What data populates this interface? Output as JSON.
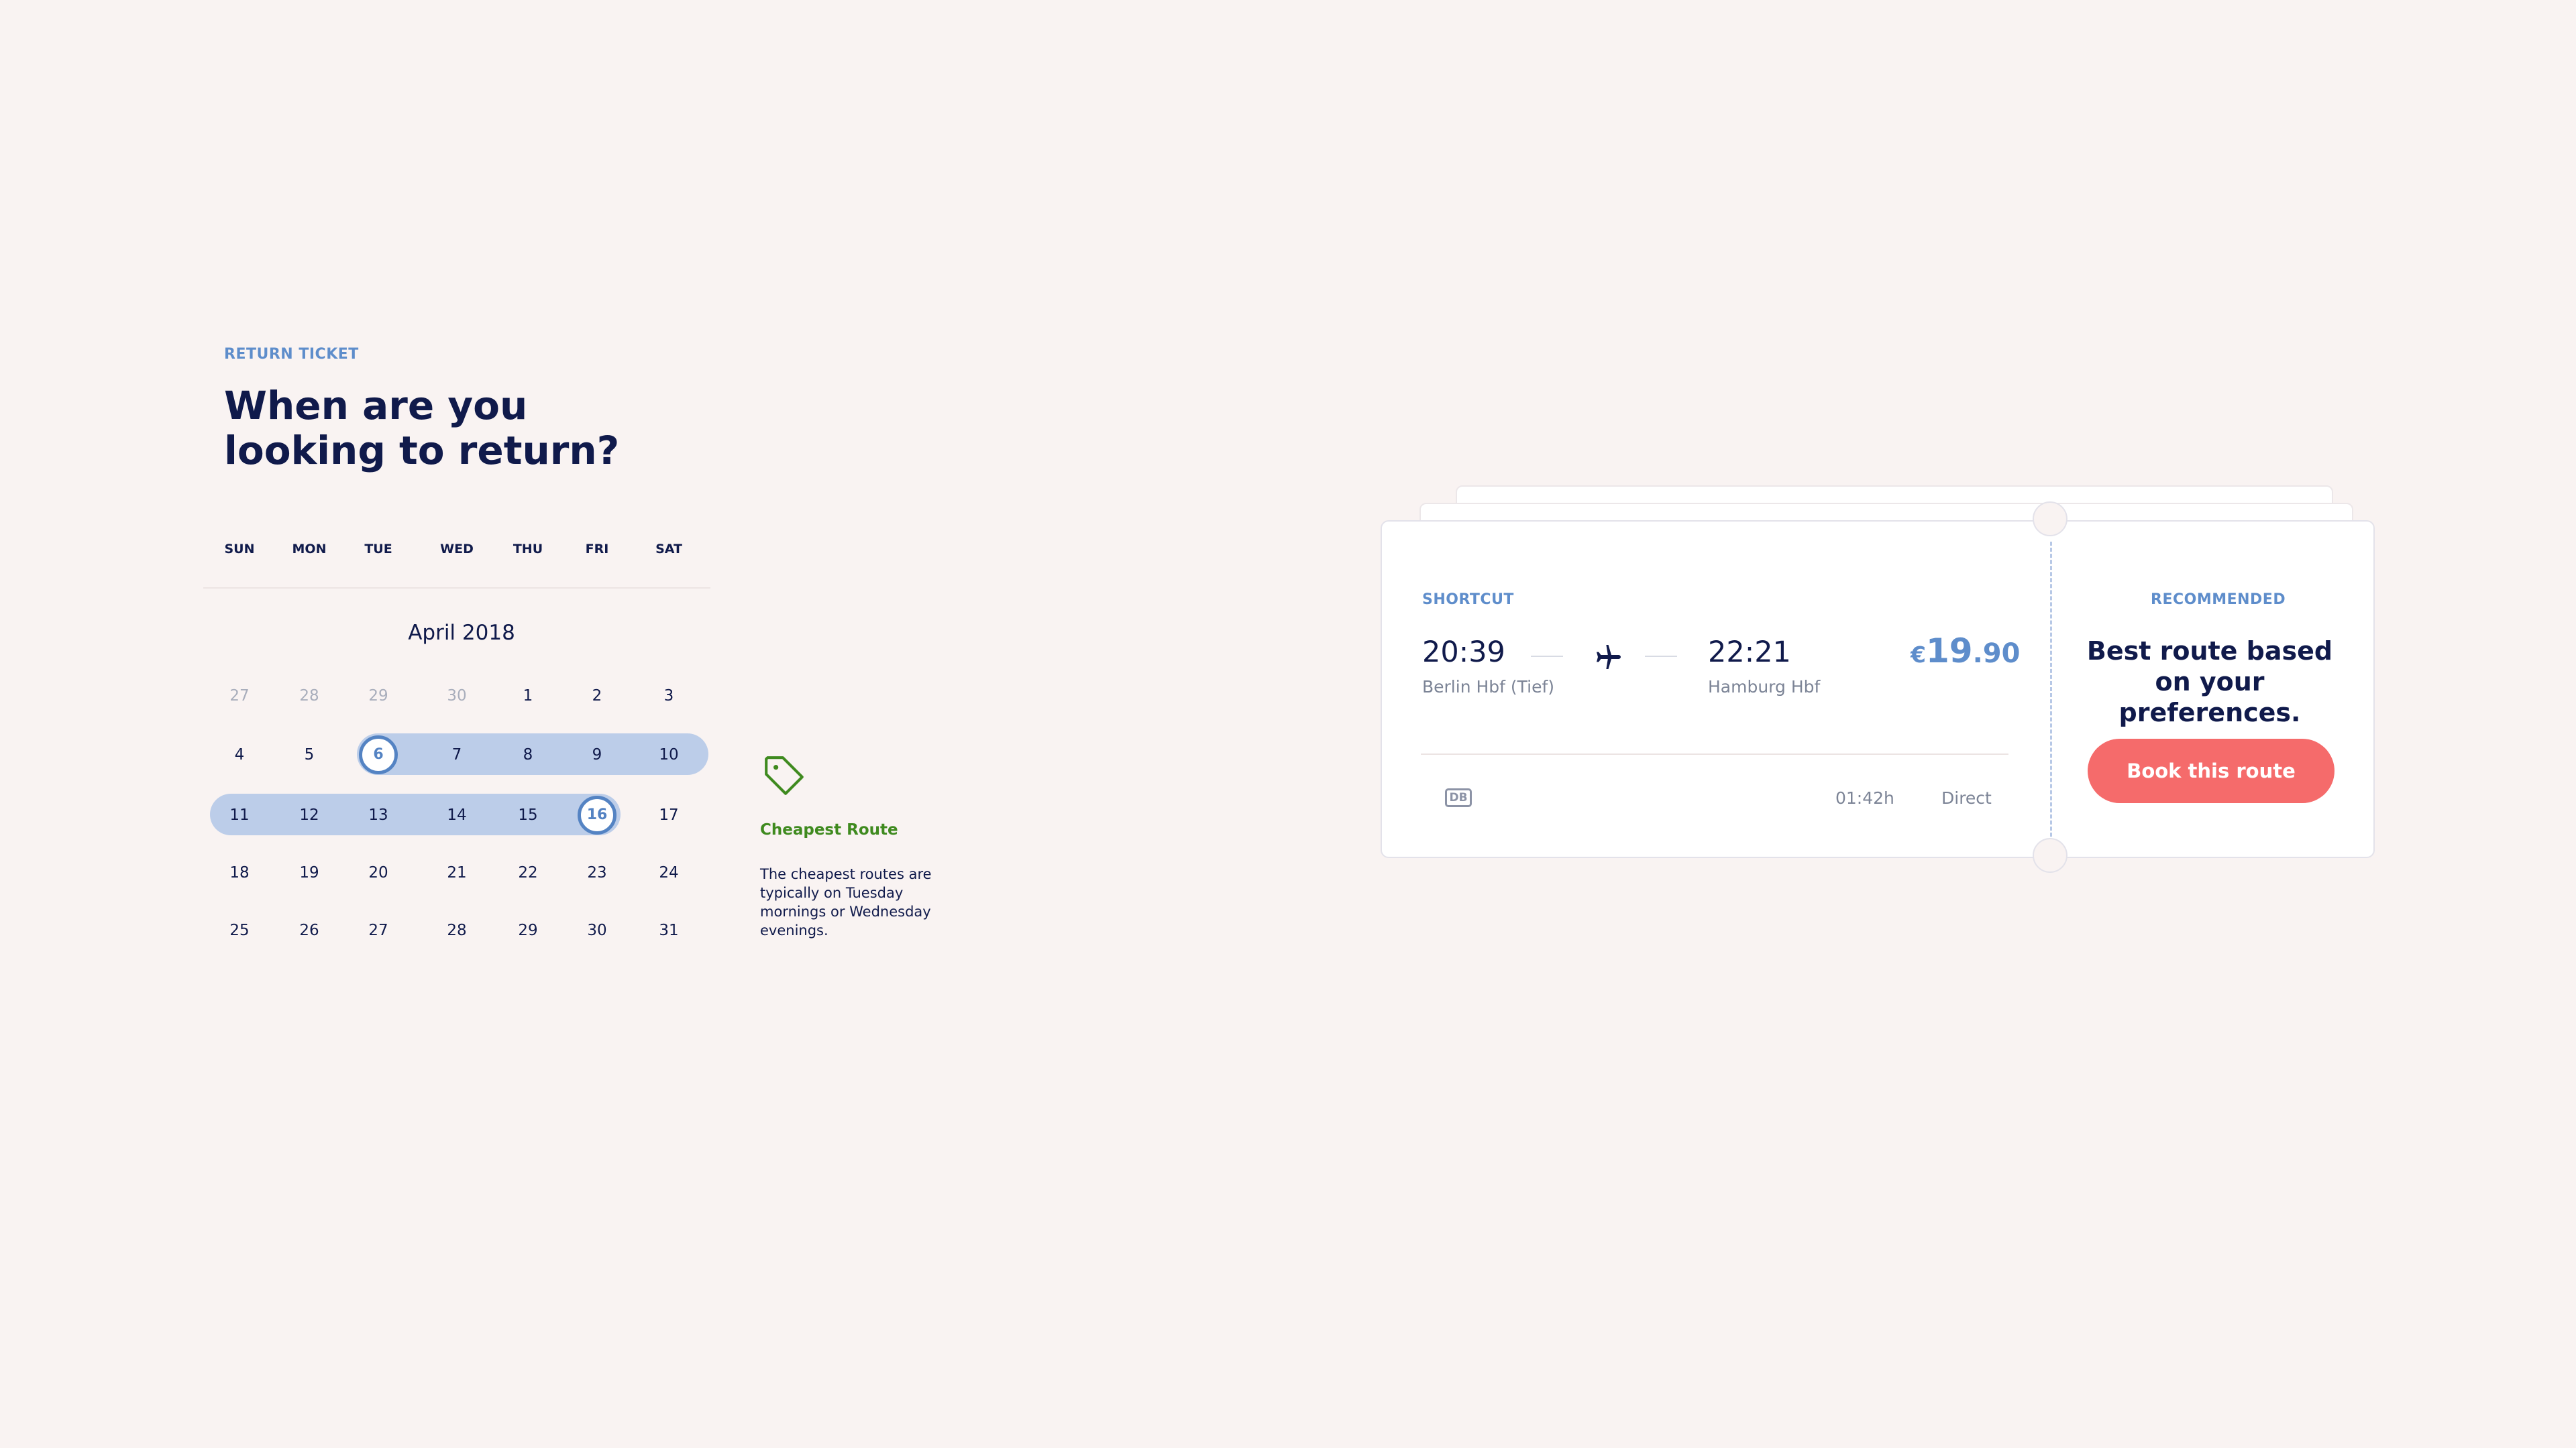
{
  "header": {
    "eyebrow": "RETURN TICKET",
    "title_line1": "When are you",
    "title_line2": "looking to return?"
  },
  "calendar": {
    "weekdays": [
      "SUN",
      "MON",
      "TUE",
      "WED",
      "THU",
      "FRI",
      "SAT"
    ],
    "month_title": "April 2018",
    "rows": [
      [
        "27",
        "28",
        "29",
        "30",
        "1",
        "2",
        "3"
      ],
      [
        "4",
        "5",
        "6",
        "7",
        "8",
        "9",
        "10"
      ],
      [
        "11",
        "12",
        "13",
        "14",
        "15",
        "16",
        "17"
      ],
      [
        "18",
        "19",
        "20",
        "21",
        "22",
        "23",
        "24"
      ],
      [
        "25",
        "26",
        "27",
        "28",
        "29",
        "30",
        "31"
      ]
    ],
    "muted_in_first_row": [
      "27",
      "28",
      "29",
      "30"
    ],
    "range_start": "6",
    "range_end": "16"
  },
  "tip": {
    "icon": "price-tag-icon",
    "title": "Cheapest Route",
    "body": "The cheapest routes are typically on Tuesday mornings or Wednesday evenings."
  },
  "ticket": {
    "eyebrow": "SHORTCUT",
    "depart_time": "20:39",
    "depart_station": "Berlin Hbf (Tief)",
    "arrive_time": "22:21",
    "arrive_station": "Hamburg Hbf",
    "transport_icon": "airplane-icon",
    "price_currency": "€",
    "price_whole": "19",
    "price_cents": ".90",
    "operator": "DB",
    "duration": "01:42h",
    "stops": "Direct"
  },
  "recommended": {
    "eyebrow": "RECOMMENDED",
    "title": "Best route based on your preferences.",
    "button_label": "Book this route"
  },
  "colors": {
    "background": "#f9f3f2",
    "navy": "#101a4b",
    "accent_blue": "#5e8dcb",
    "range_fill": "#bccde9",
    "tip_green": "#3f8a1f",
    "cta": "#f56b6b"
  }
}
